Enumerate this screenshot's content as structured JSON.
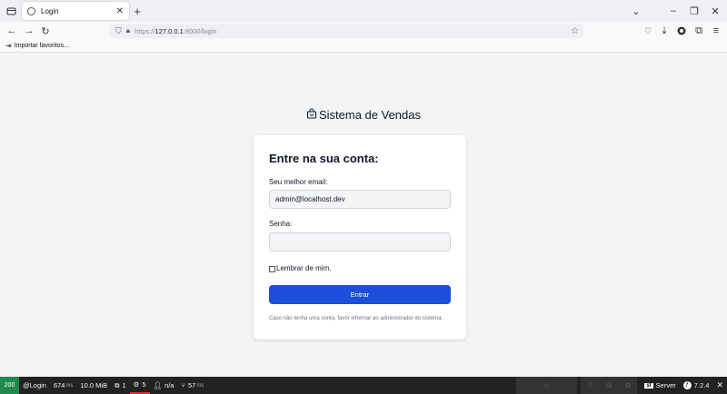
{
  "browser": {
    "tab_title": "Login",
    "new_tab_label": "+",
    "url_scheme": "https://",
    "url_host": "127.0.0.1",
    "url_rest": ":8000/login",
    "bookmark_import": "Importar favoritos..."
  },
  "page": {
    "brand": "Sistema de Vendas",
    "card_title": "Entre na sua conta:",
    "email_label": "Seu melhor email:",
    "email_value": "admin@localhost.dev",
    "password_label": "Senha:",
    "password_value": "",
    "remember_label": "Lembrar de mim.",
    "submit_label": "Entrar",
    "note": "Caso não tenha uma conta, favor informar ao administrador do sistema."
  },
  "debug_toolbar": {
    "status": "200",
    "route": "@Login",
    "time_value": "674",
    "time_unit": "ms",
    "memory": "10.0 MiB",
    "views_count": "1",
    "queries_count": "5",
    "user": "n/a",
    "request_time_value": "57",
    "request_time_unit": "ms",
    "server_label": "Server",
    "version": "7.2.4"
  },
  "colors": {
    "accent": "#1d4ed8",
    "page_bg": "#f3f4f6",
    "status_ok": "#1f8a4c"
  }
}
